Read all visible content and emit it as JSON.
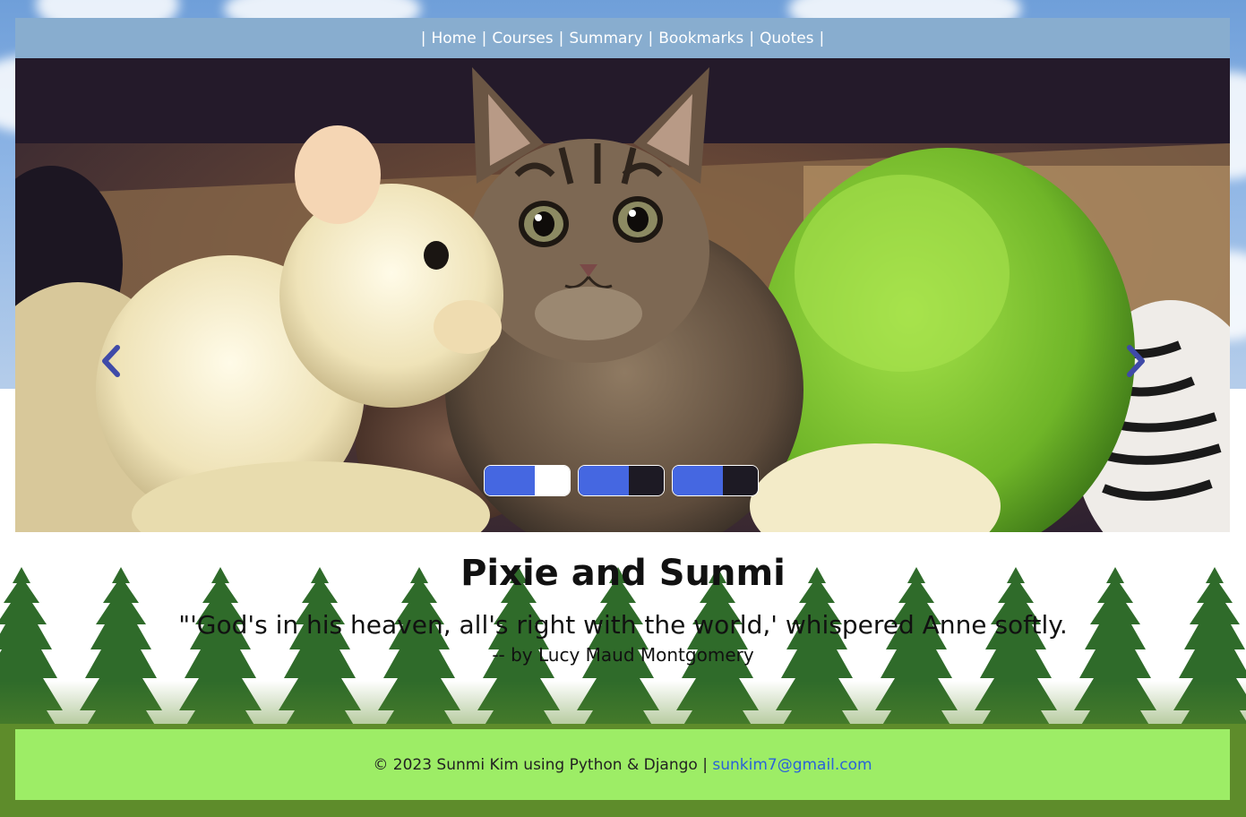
{
  "nav": {
    "separator": "|",
    "items": [
      {
        "label": "Home"
      },
      {
        "label": "Courses"
      },
      {
        "label": "Summary"
      },
      {
        "label": "Bookmarks"
      },
      {
        "label": "Quotes"
      }
    ]
  },
  "carousel": {
    "prev_icon": "chevron-left-icon",
    "next_icon": "chevron-right-icon",
    "indicator_count": 3,
    "active_index": 0,
    "colors": {
      "indicator_fill": "#4567e1",
      "arrow": "#3f4aa8"
    }
  },
  "caption": {
    "title": "Pixie and Sunmi",
    "quote": "\"'God's in his heaven, all's right with the world,' whispered Anne softly.",
    "author": "-- by Lucy Maud Montgomery"
  },
  "footer": {
    "copyright": "© 2023 Sunmi Kim using Python & Django |",
    "email": "sunkim7@gmail.com"
  },
  "colors": {
    "nav_bg": "#88adcf",
    "footer_bg": "#9ded66",
    "link": "#2a62d9",
    "tree": "#2f6b2a",
    "grass": "#5e8c2b"
  }
}
